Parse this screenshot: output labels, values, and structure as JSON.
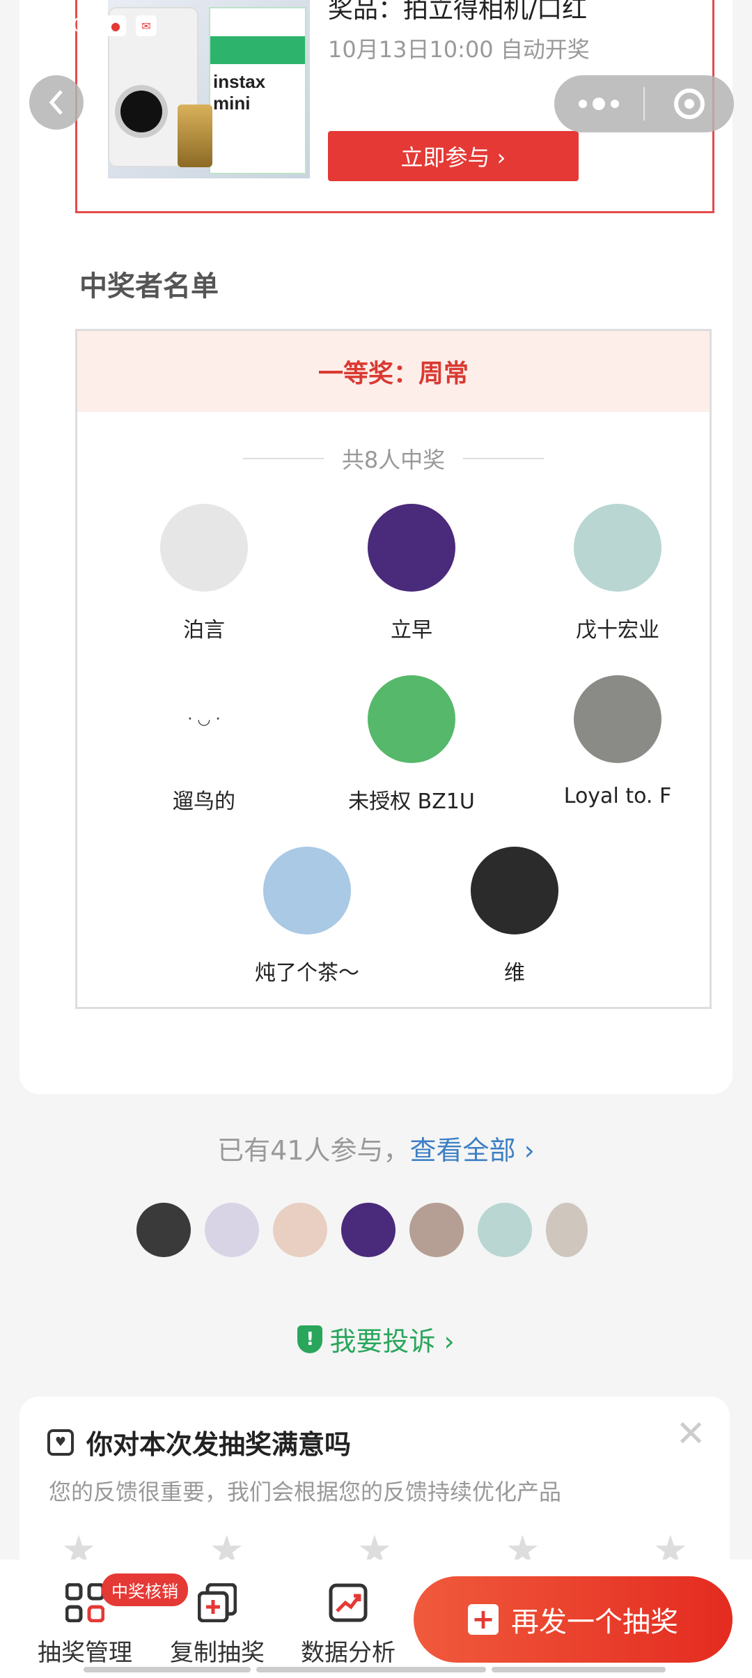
{
  "status_bar": {
    "time": "11:09"
  },
  "prize": {
    "title": "奖品：拍立得相机/口红",
    "time": "10月13日10:00 自动开奖",
    "join_label": "立即参与 ›",
    "image_brand": "instax mini"
  },
  "winners": {
    "section_title": "中奖者名单",
    "tier": "一等奖：周常",
    "count": "共8人中奖",
    "names": [
      "泊言",
      "立早",
      "戊十宏业",
      "遛鸟的",
      "未授权 BZ1U",
      "Loyal to. F",
      "炖了个茶～",
      "维"
    ]
  },
  "participants": {
    "text": "已有41人参与，",
    "link": "查看全部 ›"
  },
  "complain": {
    "label": "我要投诉 ›"
  },
  "feedback": {
    "title": "你对本次发抽奖满意吗",
    "subtitle": "您的反馈很重要，我们会根据您的反馈持续优化产品",
    "close": "✕"
  },
  "bottom_bar": {
    "tabs": [
      "抽奖管理",
      "复制抽奖",
      "数据分析"
    ],
    "badge": "中奖核销",
    "cta": "再发一个抽奖"
  },
  "colors": {
    "accent": "#e53935",
    "link": "#3d7fc4",
    "green": "#2aa65c"
  }
}
